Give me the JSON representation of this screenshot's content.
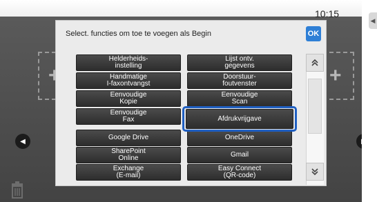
{
  "status": {
    "time": "10:15"
  },
  "dialog": {
    "title": "Select. functies om toe te voegen als Begin",
    "ok_label": "OK"
  },
  "functions": [
    {
      "label": "Helderheids-\ninstelling"
    },
    {
      "label": "Lijst ontv.\ngegevens"
    },
    {
      "label": "Handmatige\nI-faxontvangst"
    },
    {
      "label": "Doorstuur-\nfoutvenster"
    },
    {
      "label": "Eenvoudige\nKopie"
    },
    {
      "label": "Eenvoudige\nScan"
    },
    {
      "label": "Eenvoudige\nFax"
    },
    {
      "label": "Afdrukvrijgave"
    },
    {
      "label": "Google Drive"
    },
    {
      "label": "OneDrive"
    },
    {
      "label": "SharePoint\nOnline"
    },
    {
      "label": "Gmail"
    },
    {
      "label": "Exchange\n(E-mail)"
    },
    {
      "label": "Easy Connect\n(QR-code)"
    }
  ],
  "icons": {
    "scroll_up": "double-chevron-up-icon",
    "scroll_down": "double-chevron-down-icon",
    "prev_page": "left-arrow-icon",
    "next_page": "right-arrow-icon",
    "trash": "trash-icon"
  },
  "colors": {
    "selection": "#1f5fc2",
    "ok_button": "#2e7fd6",
    "function_button": "#333333"
  }
}
